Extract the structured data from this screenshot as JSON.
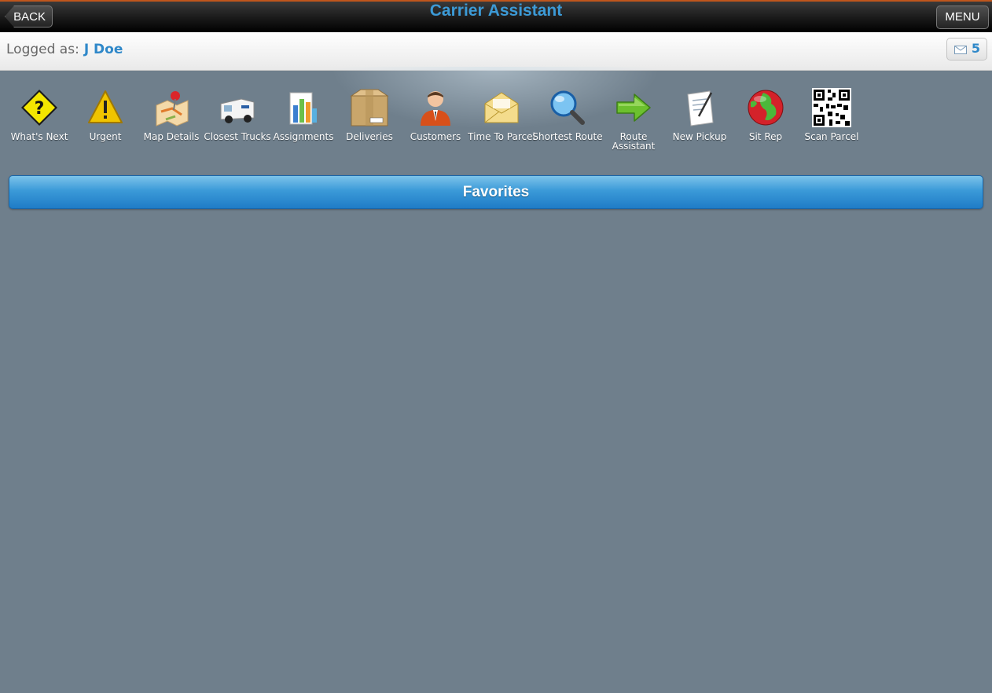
{
  "header": {
    "title": "Carrier Assistant",
    "back_label": "BACK",
    "menu_label": "MENU"
  },
  "login": {
    "label": "Logged as:",
    "user": "J Doe",
    "message_count": "5",
    "message_icon": "envelope-icon"
  },
  "toolbar": {
    "items": [
      {
        "label": "What's Next",
        "icon": "question-sign-icon"
      },
      {
        "label": "Urgent",
        "icon": "warning-icon"
      },
      {
        "label": "Map Details",
        "icon": "map-pin-icon"
      },
      {
        "label": "Closest Trucks",
        "icon": "truck-icon"
      },
      {
        "label": "Assignments",
        "icon": "bar-chart-icon"
      },
      {
        "label": "Deliveries",
        "icon": "box-icon"
      },
      {
        "label": "Customers",
        "icon": "person-icon"
      },
      {
        "label": "Time To Parcel",
        "icon": "envelope-icon"
      },
      {
        "label": "Shortest Route",
        "icon": "magnifier-icon"
      },
      {
        "label": "Route Assistant",
        "icon": "arrow-right-icon"
      },
      {
        "label": "New Pickup",
        "icon": "document-pen-icon"
      },
      {
        "label": "Sit Rep",
        "icon": "globe-icon"
      },
      {
        "label": "Scan Parcel",
        "icon": "qr-code-icon"
      }
    ]
  },
  "favorites": {
    "label": "Favorites"
  },
  "colors": {
    "background": "#6f7f8c",
    "accent": "#2f88c9",
    "title": "#3c9ad6"
  }
}
